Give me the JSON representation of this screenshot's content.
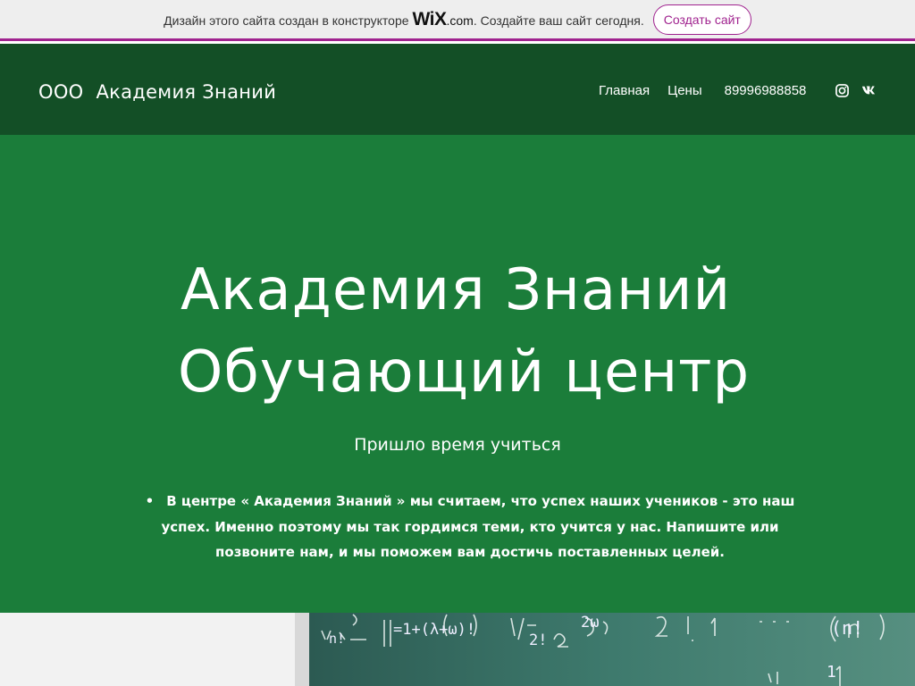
{
  "wix_banner": {
    "text_before": "Дизайн этого сайта создан в конструкторе",
    "logo_main": "WiX",
    "logo_suffix": ".com",
    "text_after": ". Создайте ваш сайт сегодня.",
    "button_label": "Создать сайт"
  },
  "header": {
    "site_title": "ООО  Академия Знаний",
    "nav": [
      "Главная",
      "Цены",
      "89996988858"
    ],
    "social_icons": [
      "instagram-icon",
      "vk-icon"
    ]
  },
  "hero": {
    "title_line1": "Академия Знаний",
    "title_line2": "Обучающий центр",
    "subtitle": "Пришло время учиться",
    "bullet": "•",
    "body": "В центре « Академия Знаний » мы считаем, что успех наших учеников - это наш успех. Именно поэтому мы так гордимся теми, кто учится у нас. Напишите или позвоните нам, и мы поможем вам достичь поставленных целей."
  },
  "colors": {
    "banner_bg": "#eeeeee",
    "wix_accent": "#a0238f",
    "header_bg": "#134f26",
    "hero_bg": "#1b7d3a",
    "text_light": "#ffffff"
  },
  "bottom_image": {
    "formula_text_1": "n!",
    "formula_text_2": "=1+(λ+ω)!",
    "formula_text_3": "2ω",
    "formula_text_4": "2!",
    "formula_text_5": "(n!",
    "formula_text_6": "1"
  }
}
